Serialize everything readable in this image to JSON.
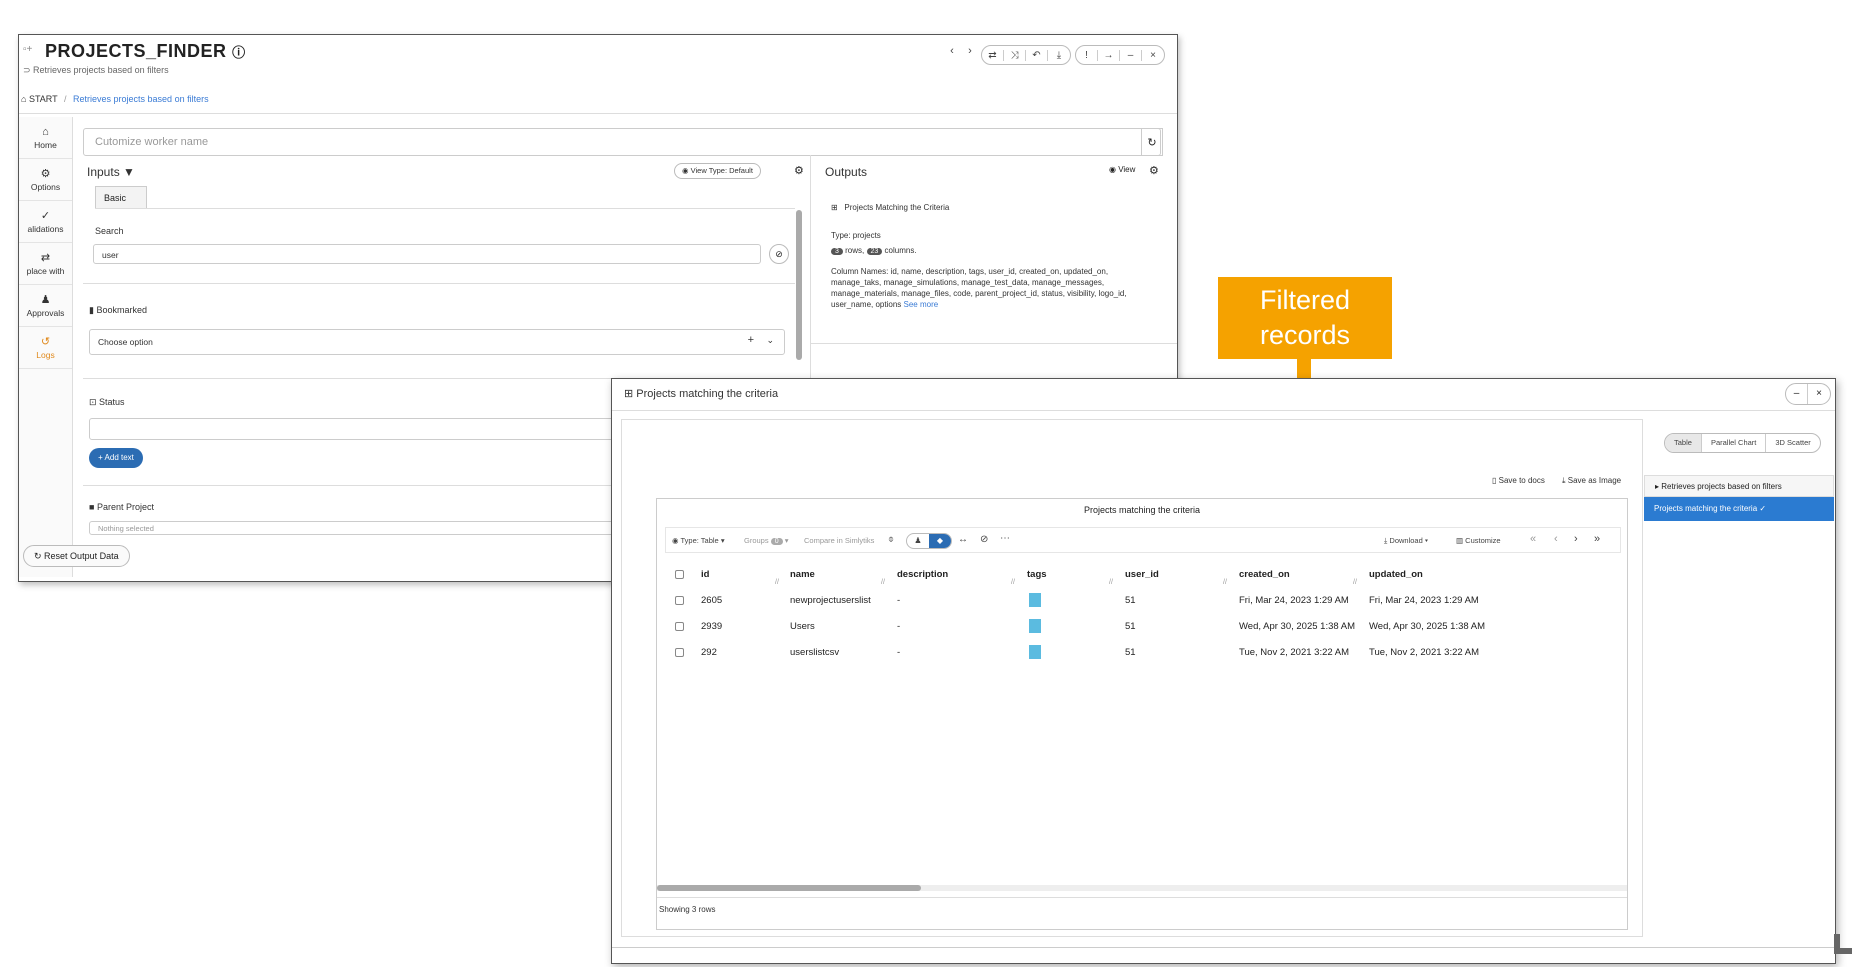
{
  "back": {
    "title": "PROJECTS_FINDER",
    "subtitle": "Retrieves projects based on filters",
    "breadcrumb_start": "START",
    "breadcrumb_sep": "/",
    "breadcrumb_current": "Retrieves projects based on filters",
    "nav": [
      {
        "label": "Home",
        "icon": "home-icon"
      },
      {
        "label": "Options",
        "icon": "gear-icon"
      },
      {
        "label": "alidations",
        "icon": "check-icon"
      },
      {
        "label": "place with",
        "icon": "swap-icon"
      },
      {
        "label": "Approvals",
        "icon": "user-icon"
      },
      {
        "label": "Logs",
        "icon": "history-icon"
      }
    ],
    "worker_placeholder": "Cutomize worker name",
    "inputs_label": "Inputs",
    "view_type": "View Type: Default",
    "basic_tab": "Basic",
    "search_label": "Search",
    "search_value": "user",
    "bookmarked_label": "Bookmarked",
    "choose_option": "Choose option",
    "status_label": "Status",
    "add_text": "+ Add text",
    "parent_project_label": "Parent Project",
    "nothing_selected": "Nothing selected",
    "reset_label": "Reset Output Data",
    "outputs_label": "Outputs",
    "outputs_view": "View",
    "out_table_title": "Projects Matching the Criteria",
    "out_type": "Type: projects",
    "rows_count": "3",
    "rows_word": "rows,",
    "cols_count": "23",
    "cols_word": "columns.",
    "column_names": "Column Names: id, name, description, tags, user_id, created_on, updated_on, manage_taks, manage_simulations, manage_test_data, manage_messages, manage_materials, manage_files, code, parent_project_id, status, visibility, logo_id, user_name, options",
    "see_more_a": "S",
    "see_more_b": "ee more"
  },
  "callout": {
    "line1": "Filtered",
    "line2": "records",
    "color": "#f5a200"
  },
  "front": {
    "title": "Projects matching the criteria",
    "save_docs": "Save to docs",
    "save_image": "Save as Image",
    "view_tabs": [
      "Table",
      "Parallel Chart",
      "3D Scatter"
    ],
    "panel_title": "Projects matching the criteria",
    "toolbar": {
      "type": "Type: Table",
      "groups": "Groups",
      "groups_count": "0",
      "compare": "Compare in Simlytiks",
      "download": "Download",
      "customize": "Customize"
    },
    "columns": [
      "id",
      "name",
      "description",
      "tags",
      "user_id",
      "created_on",
      "updated_on"
    ],
    "rows": [
      {
        "id": "2605",
        "name": "newprojectuserslist",
        "description": "-",
        "user_id": "51",
        "created_on": "Fri, Mar 24, 2023 1:29 AM",
        "updated_on": "Fri, Mar 24, 2023 1:29 AM"
      },
      {
        "id": "2939",
        "name": "Users",
        "description": "-",
        "user_id": "51",
        "created_on": "Wed, Apr 30, 2025 1:38 AM",
        "updated_on": "Wed, Apr 30, 2025 1:38 AM"
      },
      {
        "id": "292",
        "name": "userslistcsv",
        "description": "-",
        "user_id": "51",
        "created_on": "Tue, Nov 2, 2021 3:22 AM",
        "updated_on": "Tue, Nov 2, 2021 3:22 AM"
      }
    ],
    "showing": "Showing 3 rows",
    "steps": [
      "Retrieves projects based on filters",
      "Projects matching the criteria"
    ],
    "accent": "#2b7bd1"
  }
}
